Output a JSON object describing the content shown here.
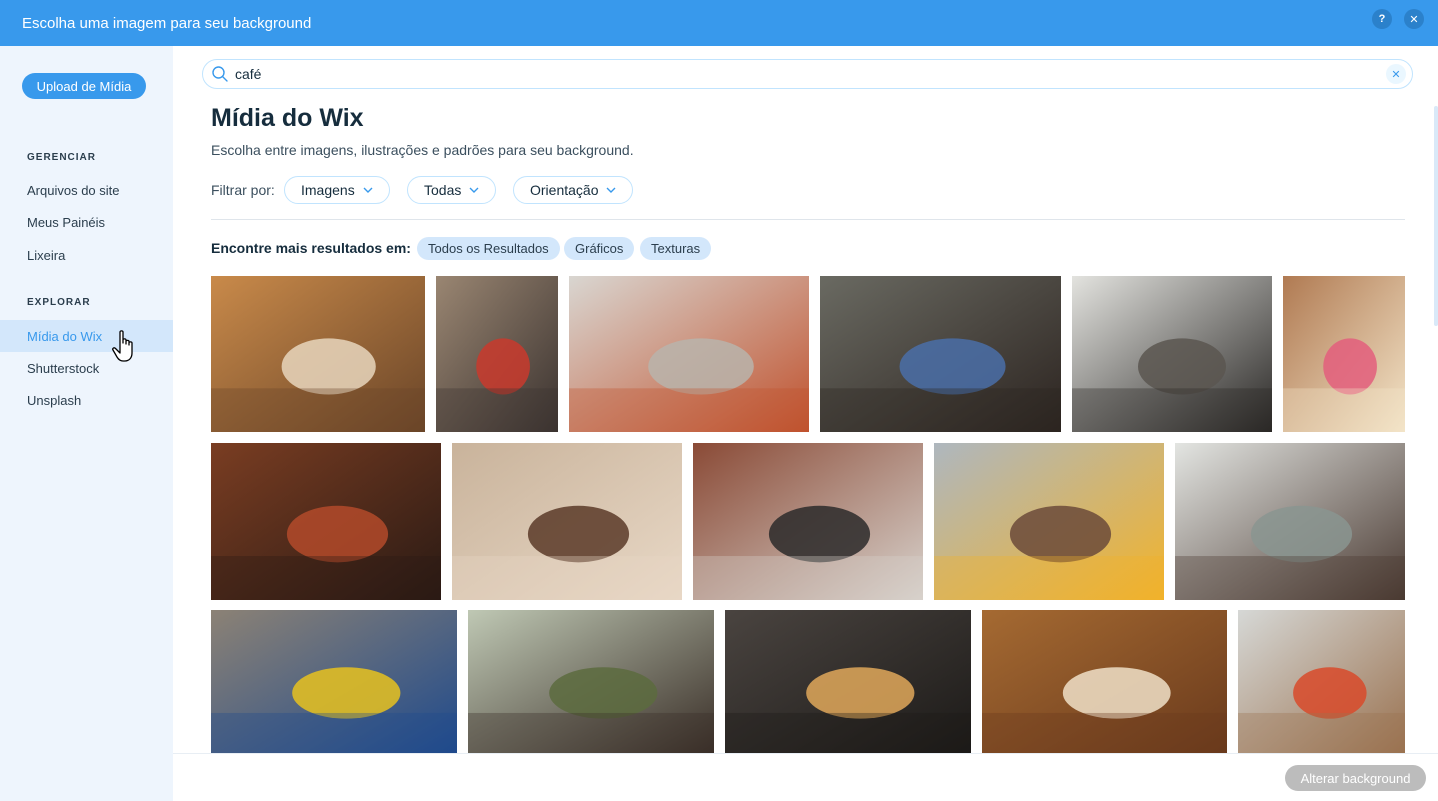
{
  "window": {
    "title": "Escolha uma imagem para seu background",
    "help_icon_label": "?",
    "close_icon_label": "✕"
  },
  "sidebar": {
    "upload_label": "Upload de Mídia",
    "sections": [
      {
        "label": "GERENCIAR",
        "items": [
          {
            "label": "Arquivos do site"
          },
          {
            "label": "Meus Painéis"
          },
          {
            "label": "Lixeira"
          }
        ]
      },
      {
        "label": "EXPLORAR",
        "items": [
          {
            "label": "Mídia do Wix",
            "active": true
          },
          {
            "label": "Shutterstock"
          },
          {
            "label": "Unsplash"
          }
        ]
      }
    ]
  },
  "search": {
    "value": "café",
    "clear_label": "✕"
  },
  "main": {
    "title": "Mídia do Wix",
    "subtitle": "Escolha entre imagens, ilustrações e padrões para seu background.",
    "filter_label": "Filtrar por:",
    "filters": [
      {
        "label": "Imagens"
      },
      {
        "label": "Todas"
      },
      {
        "label": "Orientação"
      }
    ],
    "more_results_label": "Encontre mais resultados em:",
    "more_results_tags": [
      {
        "label": "Todos os Resultados"
      },
      {
        "label": "Gráficos"
      },
      {
        "label": "Texturas"
      }
    ]
  },
  "images": [
    {
      "name": "tray-coffee-jars",
      "palette": [
        "#c98a4a",
        "#e8d6bd",
        "#6a4528"
      ]
    },
    {
      "name": "pour-over-red-dripper",
      "palette": [
        "#9a8672",
        "#c9392d",
        "#3b3330"
      ]
    },
    {
      "name": "book-on-glass-table",
      "palette": [
        "#d9d6d1",
        "#b9b4ac",
        "#c0522e"
      ]
    },
    {
      "name": "barista-pouring-coffee",
      "palette": [
        "#6a6a62",
        "#4a6fa8",
        "#2c2420"
      ]
    },
    {
      "name": "woman-at-cafe-window",
      "palette": [
        "#e3e3df",
        "#5a5650",
        "#2a2826"
      ]
    },
    {
      "name": "friends-table-flowers",
      "palette": [
        "#b07a52",
        "#e35e7d",
        "#f3e4c8"
      ]
    },
    {
      "name": "woman-drinking-coffee-bar",
      "palette": [
        "#7a3d22",
        "#b34a2a",
        "#2a1a14"
      ]
    },
    {
      "name": "woman-glasses-latte",
      "palette": [
        "#c9b39b",
        "#5a3a28",
        "#e8d8c6"
      ]
    },
    {
      "name": "barista-latte-art-brick",
      "palette": [
        "#8a4a36",
        "#2b2a2a",
        "#d8d2cc"
      ]
    },
    {
      "name": "smiling-man-beanie",
      "palette": [
        "#aeb7bf",
        "#6b4a3a",
        "#f2b32a"
      ]
    },
    {
      "name": "cafe-interior-man",
      "palette": [
        "#e3e5e2",
        "#8a9590",
        "#4a3a32"
      ]
    },
    {
      "name": "latte-cups-yellow-blue",
      "palette": [
        "#8c8275",
        "#e8c21e",
        "#1f4a8c"
      ]
    },
    {
      "name": "cafe-table-plants",
      "palette": [
        "#bfc8b4",
        "#5c6b3e",
        "#3a2f28"
      ]
    },
    {
      "name": "pao-de-queijo-coffee",
      "palette": [
        "#4a4440",
        "#e0a85a",
        "#1c1a18"
      ]
    },
    {
      "name": "cup-on-books-sunlight",
      "palette": [
        "#a56a32",
        "#f0e0c8",
        "#6a3a1c"
      ]
    },
    {
      "name": "modern-cafe-counter",
      "palette": [
        "#d6d8d6",
        "#d84a2a",
        "#9a7250"
      ]
    }
  ],
  "footer": {
    "apply_label": "Alterar background"
  }
}
